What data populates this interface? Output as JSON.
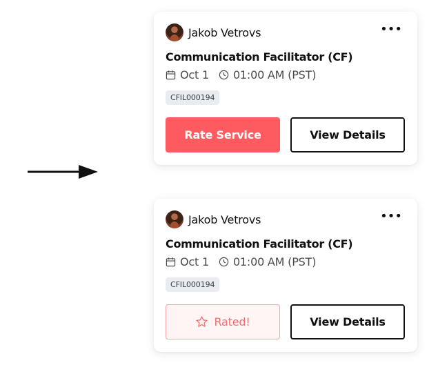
{
  "colors": {
    "accent": "#fd5b5f",
    "rated_border": "#f9a4a6",
    "rated_text": "#f26e71",
    "badge_bg": "#e9edf1"
  },
  "arrow": {
    "icon": "arrow-right-icon"
  },
  "cards": [
    {
      "state": "unrated",
      "user_name": "Jakob Vetrovs",
      "more_icon": "more-horizontal-icon",
      "title": "Communication Facilitator (CF)",
      "date": "Oct 1",
      "time": "01:00 AM (PST)",
      "code": "CFIL000194",
      "primary_button": "Rate Service",
      "secondary_button": "View Details"
    },
    {
      "state": "rated",
      "user_name": "Jakob Vetrovs",
      "more_icon": "more-horizontal-icon",
      "title": "Communication Facilitator (CF)",
      "date": "Oct 1",
      "time": "01:00 AM (PST)",
      "code": "CFIL000194",
      "primary_button": "Rated!",
      "primary_icon": "star-icon",
      "secondary_button": "View Details"
    }
  ]
}
